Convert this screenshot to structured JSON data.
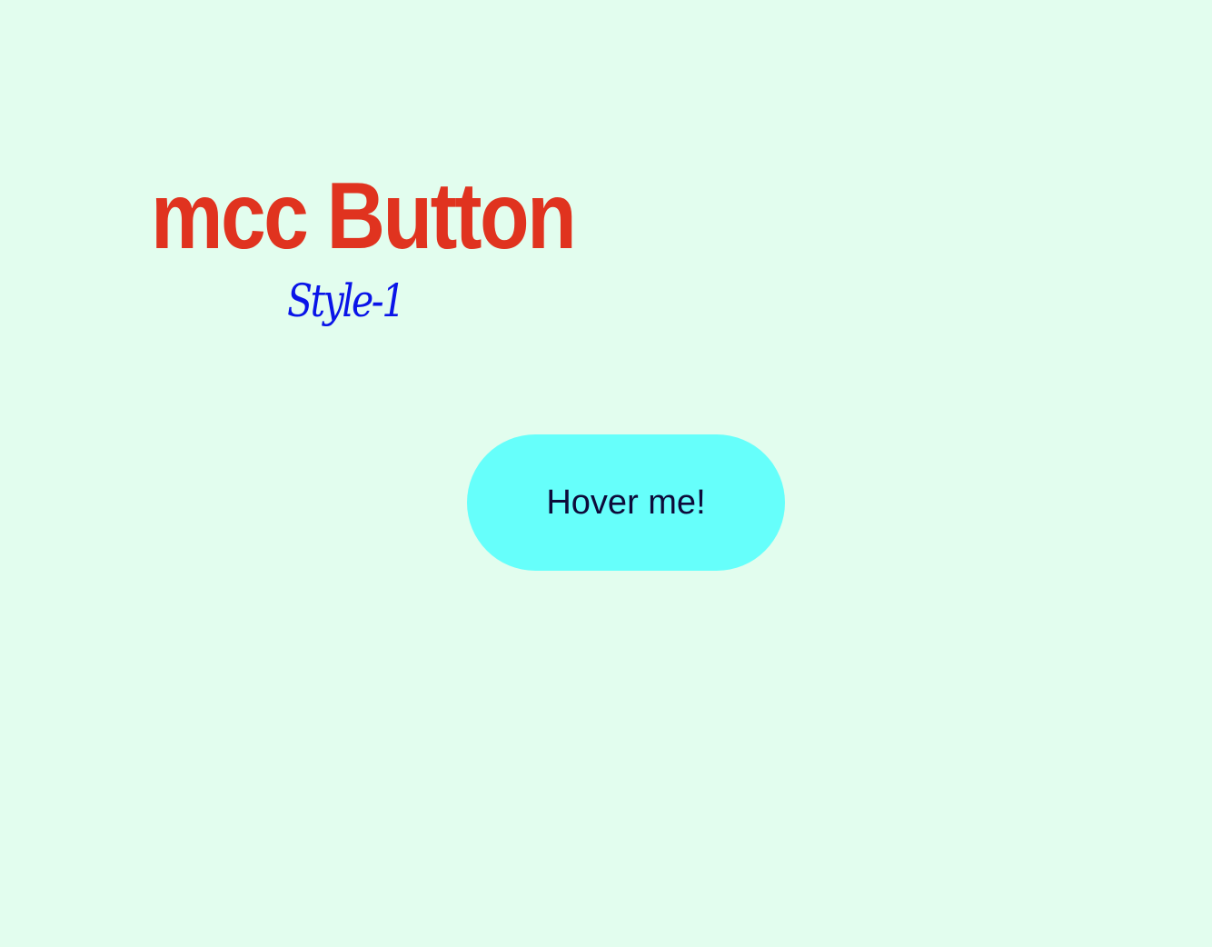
{
  "page": {
    "title": "mcc Button",
    "subtitle": "Style-1"
  },
  "button": {
    "label": "Hover me!"
  },
  "colors": {
    "background": "#e2fdee",
    "title": "#e0331f",
    "subtitle": "#0a14e8",
    "button_bg": "#66fffb",
    "button_text": "#0d0b3a"
  }
}
